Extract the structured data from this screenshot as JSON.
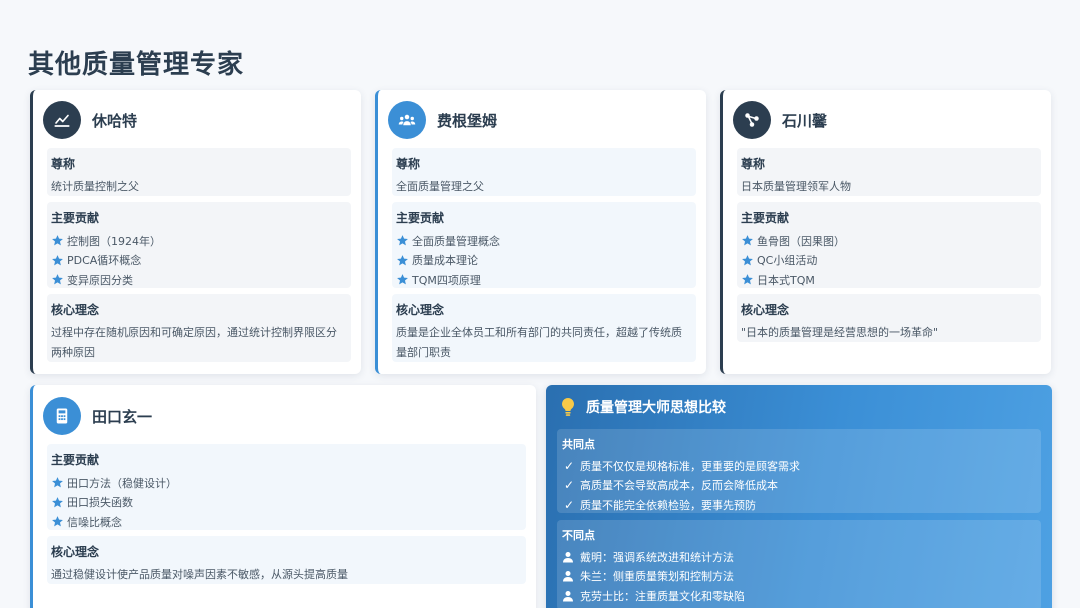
{
  "page": {
    "title": "其他质量管理专家"
  },
  "experts": [
    {
      "name": "休哈特",
      "icon": "line-chart-icon",
      "honorific_label": "尊称",
      "honorific": "统计质量控制之父",
      "contrib_label": "主要贡献",
      "contributions": [
        "控制图（1924年）",
        "PDCA循环概念",
        "变异原因分类"
      ],
      "idea_label": "核心理念",
      "idea": "过程中存在随机原因和可确定原因，通过统计控制界限区分两种原因"
    },
    {
      "name": "费根堡姆",
      "icon": "users-icon",
      "honorific_label": "尊称",
      "honorific": "全面质量管理之父",
      "contrib_label": "主要贡献",
      "contributions": [
        "全面质量管理概念",
        "质量成本理论",
        "TQM四项原理"
      ],
      "idea_label": "核心理念",
      "idea": "质量是企业全体员工和所有部门的共同责任，超越了传统质量部门职责"
    },
    {
      "name": "石川馨",
      "icon": "sitemap-icon",
      "honorific_label": "尊称",
      "honorific": "日本质量管理领军人物",
      "contrib_label": "主要贡献",
      "contributions": [
        "鱼骨图（因果图）",
        "QC小组活动",
        "日本式TQM"
      ],
      "idea_label": "核心理念",
      "idea": "\"日本的质量管理是经营思想的一场革命\""
    },
    {
      "name": "田口玄一",
      "icon": "calculator-icon",
      "contrib_label": "主要贡献",
      "contributions": [
        "田口方法（稳健设计）",
        "田口损失函数",
        "信噪比概念"
      ],
      "idea_label": "核心理念",
      "idea": "通过稳健设计使产品质量对噪声因素不敏感，从源头提高质量"
    }
  ],
  "comparison": {
    "title": "质量管理大师思想比较",
    "common_label": "共同点",
    "common": [
      "质量不仅仅是规格标准，更重要的是顾客需求",
      "高质量不会导致高成本，反而会降低成本",
      "质量不能完全依赖检验，要事先预防"
    ],
    "diff_label": "不同点",
    "differences": [
      "戴明：强调系统改进和统计方法",
      "朱兰：侧重质量策划和控制方法",
      "克劳士比：注重质量文化和零缺陷"
    ],
    "check_mark": "✓"
  },
  "colors": {
    "dark": "#2c3e50",
    "blue": "#3b8fd6",
    "star": "#3b8fd6"
  }
}
